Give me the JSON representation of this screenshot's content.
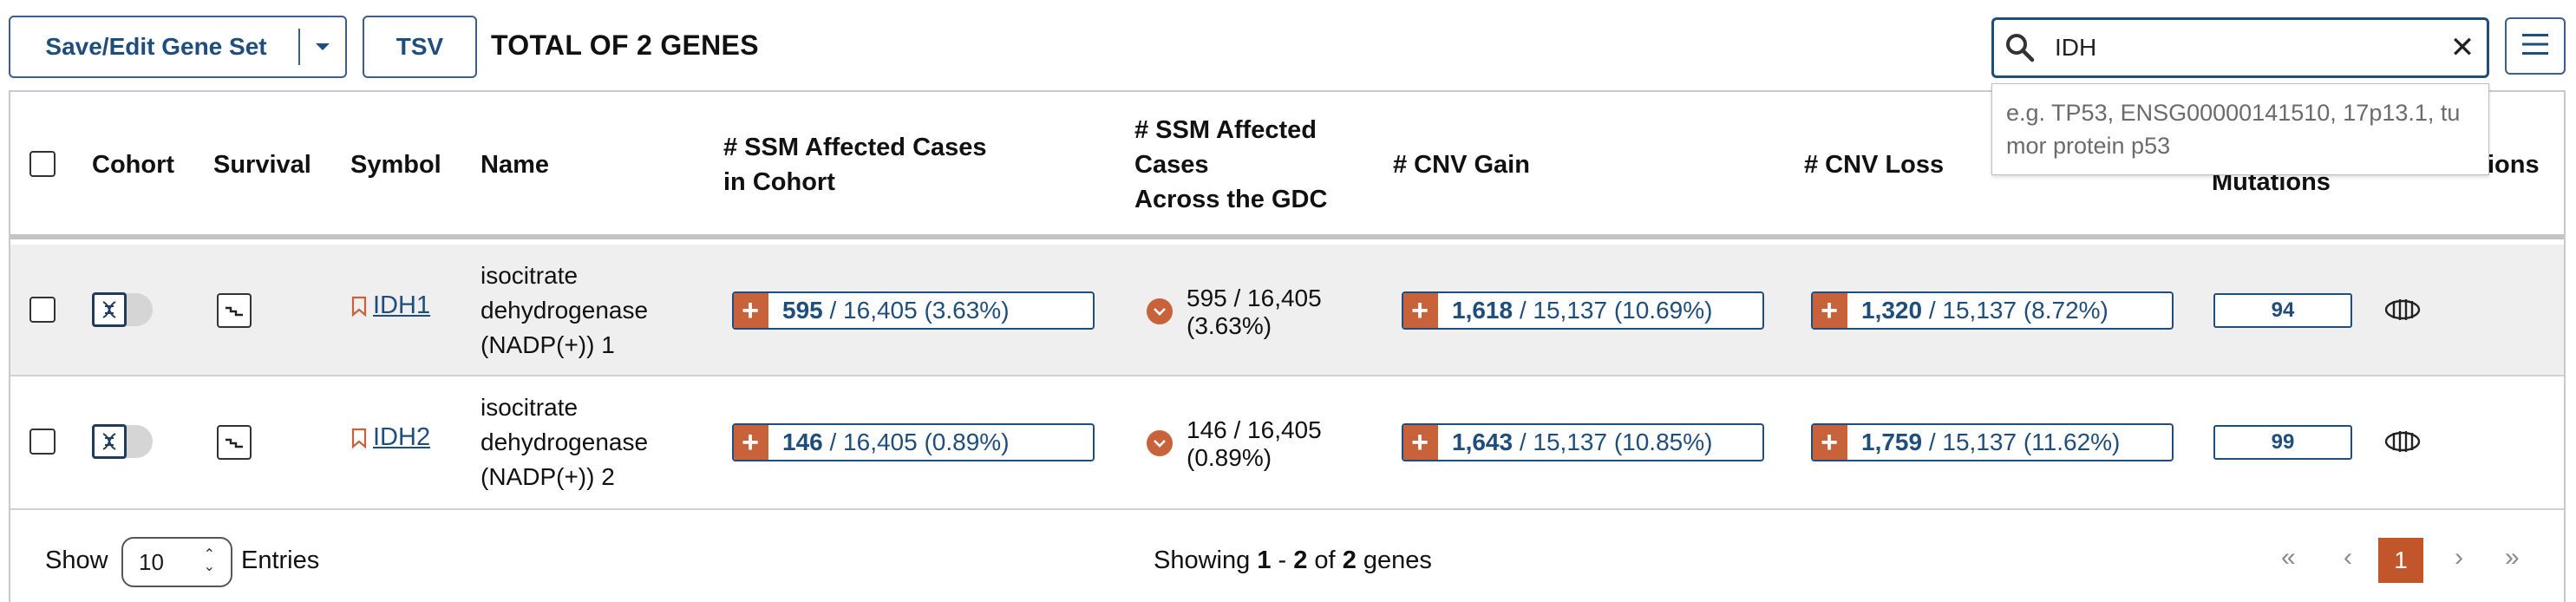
{
  "toolbar": {
    "save_edit_label": "Save/Edit Gene Set",
    "tsv_label": "TSV",
    "total_label": "TOTAL OF 2 GENES"
  },
  "search": {
    "value": "IDH",
    "hint": "e.g. TP53, ENSG00000141510, 17p13.1, tumor protein p53"
  },
  "columns": {
    "cohort": "Cohort",
    "survival": "Survival",
    "symbol": "Symbol",
    "name": "Name",
    "ssm_cohort_line1": "# SSM Affected Cases",
    "ssm_cohort_line2": "in Cohort",
    "ssm_gdc_line1": "# SSM Affected",
    "ssm_gdc_line2": "Cases",
    "ssm_gdc_line3": "Across the GDC",
    "cnv_gain": "# CNV Gain",
    "cnv_loss": "# CNV Loss",
    "mutations": "Mutations",
    "annotations_partial": "ions"
  },
  "rows": [
    {
      "symbol": "IDH1",
      "name_line1": "isocitrate",
      "name_line2": "dehydrogenase",
      "name_line3": "(NADP(+)) 1",
      "ssm_cohort_count": "595",
      "ssm_cohort_rest": " / 16,405 (3.63%)",
      "ssm_cohort_fraction": 0.0363,
      "ssm_gdc_line1": "595 / 16,405",
      "ssm_gdc_line2": "(3.63%)",
      "cnv_gain_count": "1,618",
      "cnv_gain_rest": " / 15,137 (10.69%)",
      "cnv_loss_count": "1,320",
      "cnv_loss_rest": " / 15,137 (8.72%)",
      "mutations": "94"
    },
    {
      "symbol": "IDH2",
      "name_line1": "isocitrate",
      "name_line2": "dehydrogenase",
      "name_line3": "(NADP(+)) 2",
      "ssm_cohort_count": "146",
      "ssm_cohort_rest": " / 16,405 (0.89%)",
      "ssm_cohort_fraction": 0.0089,
      "ssm_gdc_line1": "146 / 16,405",
      "ssm_gdc_line2": "(0.89%)",
      "cnv_gain_count": "1,643",
      "cnv_gain_rest": " / 15,137 (10.85%)",
      "cnv_loss_count": "1,759",
      "cnv_loss_rest": " / 15,137 (11.62%)",
      "mutations": "99"
    }
  ],
  "footer": {
    "show_label": "Show",
    "page_size": "10",
    "entries_label": "Entries",
    "showing_prefix": "Showing ",
    "range_start": "1",
    "range_sep": " - ",
    "range_end": "2",
    "of_label": " of ",
    "total": "2",
    "genes_label": " genes",
    "current_page": "1"
  },
  "colors": {
    "accent_orange": "#c8623a",
    "primary_blue": "#1f4e7d"
  }
}
